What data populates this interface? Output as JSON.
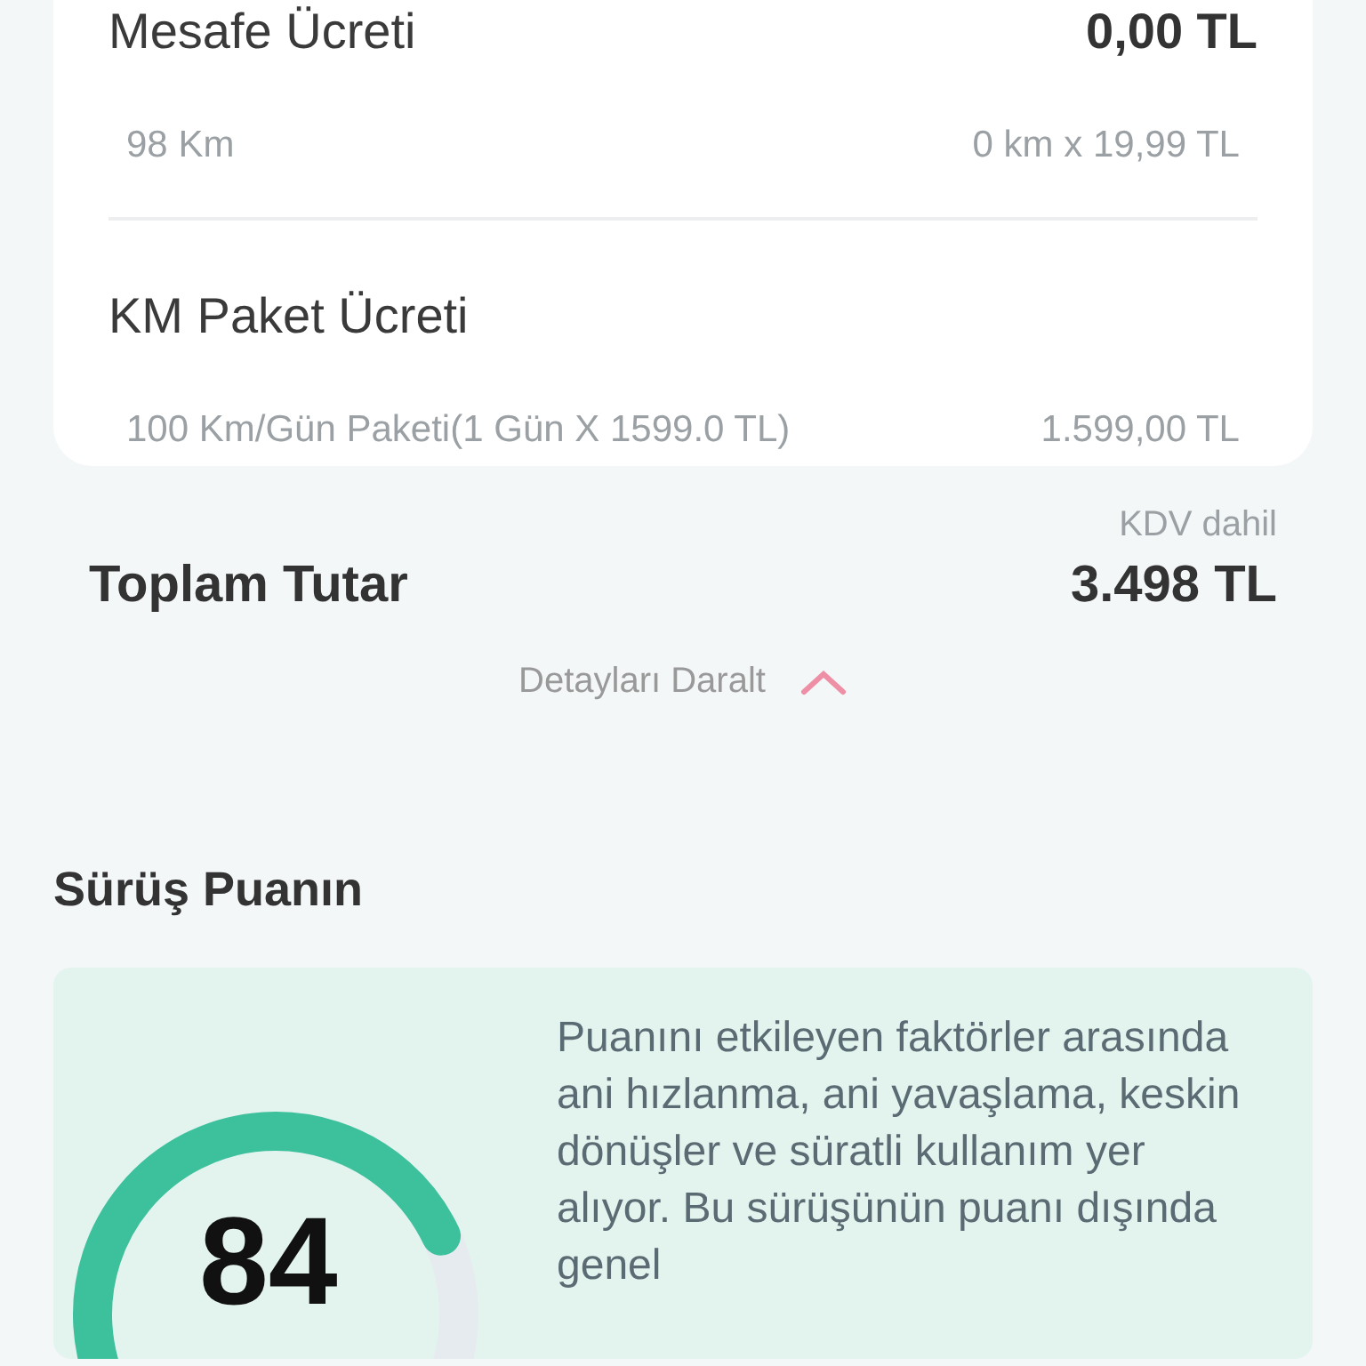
{
  "fees": [
    {
      "title": "Mesafe Ücreti",
      "amount": "0,00 TL",
      "detail": "98 Km",
      "detail_value": "0 km x 19,99 TL"
    },
    {
      "title": "KM Paket Ücreti",
      "detail": "100 Km/Gün Paketi(1 Gün X 1599.0 TL)",
      "detail_value": "1.599,00 TL"
    }
  ],
  "total": {
    "note": "KDV dahil",
    "label": "Toplam Tutar",
    "amount": "3.498 TL"
  },
  "collapse_link": "Detayları Daralt",
  "score_section": {
    "title": "Sürüş Puanın",
    "score": "84",
    "description": "Puanını etkileyen faktörler arasında ani hızlanma, ani yavaşlama, keskin dönüşler ve süratli kullanım yer alıyor. Bu sürüşünün puanı dışında genel"
  }
}
